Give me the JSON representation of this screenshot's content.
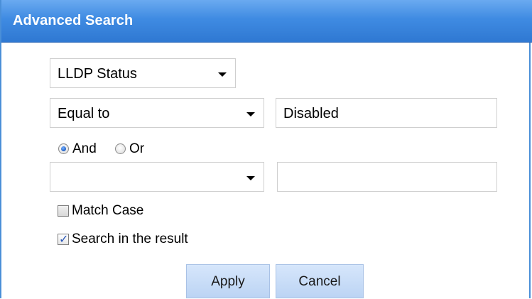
{
  "dialog": {
    "title": "Advanced Search",
    "field_select": {
      "value": "LLDP Status"
    },
    "row1": {
      "operator": "Equal to",
      "value": "Disabled"
    },
    "logic": {
      "and_label": "And",
      "or_label": "Or",
      "selected": "And"
    },
    "row2": {
      "operator": "",
      "value": ""
    },
    "options": {
      "match_case_label": "Match Case",
      "match_case_checked": false,
      "search_in_result_label": "Search in the result",
      "search_in_result_checked": true
    },
    "buttons": {
      "apply": "Apply",
      "cancel": "Cancel"
    }
  },
  "colors": {
    "titlebar": "#3f8be2",
    "button_bg": "#c8dcf7"
  }
}
